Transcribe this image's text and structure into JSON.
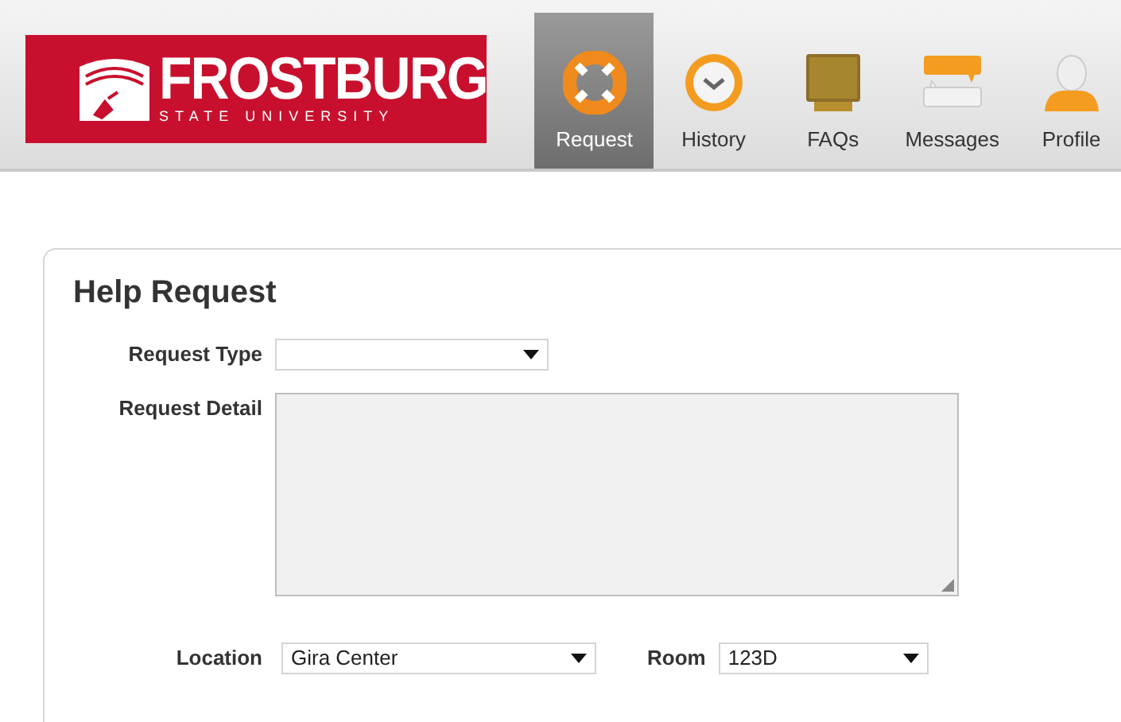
{
  "logo": {
    "name": "FROSTBURG",
    "subtitle": "STATE UNIVERSITY"
  },
  "nav": [
    {
      "label": "Request",
      "kind": "lifebuoy",
      "selected": true
    },
    {
      "label": "History",
      "kind": "clock",
      "selected": false
    },
    {
      "label": "FAQs",
      "kind": "book",
      "selected": false
    },
    {
      "label": "Messages",
      "kind": "chat",
      "selected": false
    },
    {
      "label": "Profile",
      "kind": "person",
      "selected": false
    }
  ],
  "form": {
    "title": "Help Request",
    "request_type": {
      "label": "Request Type"
    },
    "request_detail": {
      "label": "Request Detail"
    },
    "location": {
      "label": "Location",
      "value": "Gira Center"
    },
    "room": {
      "label": "Room",
      "value": "123D"
    }
  }
}
